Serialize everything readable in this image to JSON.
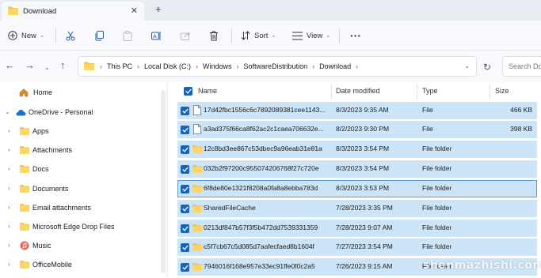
{
  "tab": {
    "title": "Download",
    "close_icon": "close-icon",
    "new_tab_icon": "plus-icon"
  },
  "toolbar": {
    "new_label": "New",
    "sort_label": "Sort",
    "view_label": "View",
    "more_label": "···"
  },
  "address": {
    "crumbs": [
      "This PC",
      "Local Disk (C:)",
      "Windows",
      "SoftwareDistribution",
      "Download"
    ],
    "search_placeholder": "Search Do"
  },
  "nav": {
    "items": [
      {
        "label": "Home",
        "icon": "home-icon",
        "expandable": false
      },
      {
        "label": "OneDrive - Personal",
        "icon": "cloud-icon",
        "expandable": true,
        "expanded": true
      },
      {
        "label": "Apps",
        "icon": "folder-icon",
        "expandable": true
      },
      {
        "label": "Attachments",
        "icon": "folder-icon",
        "expandable": true
      },
      {
        "label": "Docs",
        "icon": "folder-icon",
        "expandable": true
      },
      {
        "label": "Documents",
        "icon": "folder-icon",
        "expandable": true
      },
      {
        "label": "Email attachments",
        "icon": "folder-icon",
        "expandable": true
      },
      {
        "label": "Microsoft Edge Drop Files",
        "icon": "folder-icon",
        "expandable": true
      },
      {
        "label": "Music",
        "icon": "music-icon",
        "expandable": true
      },
      {
        "label": "OfficeMobile",
        "icon": "folder-icon",
        "expandable": true
      }
    ]
  },
  "columns": {
    "name": "Name",
    "date": "Date modified",
    "type": "Type",
    "size": "Size"
  },
  "files": [
    {
      "name": "17d42fbc1556c6c7892089381cee1143...",
      "date": "8/3/2023 9:35 AM",
      "type": "File",
      "size": "466 KB",
      "icon": "file-icon"
    },
    {
      "name": "a3ad375f66ca8f62ac2c1caea706632e...",
      "date": "8/2/2023 9:30 PM",
      "type": "File",
      "size": "398 KB",
      "icon": "file-icon"
    },
    {
      "name": "12c8bd3ee867c53dbec9a96eab31e81a",
      "date": "8/3/2023 3:54 PM",
      "type": "File folder",
      "size": "",
      "icon": "folder-icon"
    },
    {
      "name": "032b2f97200c955074206768f27c720e",
      "date": "8/3/2023 3:54 PM",
      "type": "File folder",
      "size": "",
      "icon": "folder-icon"
    },
    {
      "name": "6f8de80e1321f8208a0fa8a8ebba783d",
      "date": "8/3/2023 3:53 PM",
      "type": "File folder",
      "size": "",
      "icon": "folder-icon"
    },
    {
      "name": "SharedFileCache",
      "date": "7/28/2023 3:35 PM",
      "type": "File folder",
      "size": "",
      "icon": "folder-icon"
    },
    {
      "name": "0213df847b57f3f5b472dd7539331359",
      "date": "7/28/2023 9:07 AM",
      "type": "File folder",
      "size": "",
      "icon": "folder-icon"
    },
    {
      "name": "c5f7cb67c5d085d7aafecfaed8b1604f",
      "date": "7/27/2023 3:54 PM",
      "type": "File folder",
      "size": "",
      "icon": "folder-icon"
    },
    {
      "name": "7946016f168e957e33ec91ffe0f0c2a5",
      "date": "7/26/2023 9:15 AM",
      "type": "File folder",
      "size": "",
      "icon": "folder-icon"
    }
  ],
  "watermark": "shenmazhishi.com",
  "colors": {
    "selection": "#cce4f7",
    "checkbox": "#1a63b8",
    "folder": "#f2c24f"
  }
}
